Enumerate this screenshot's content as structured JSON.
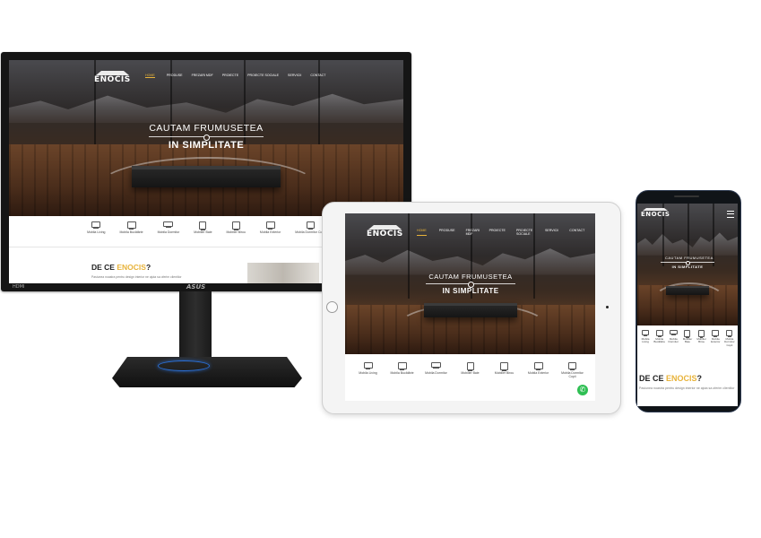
{
  "site": {
    "logo": "ENOCIS",
    "nav": [
      "Home",
      "Produse",
      "Frezari MDF",
      "Proiecte",
      "Proiecte Sociale",
      "Servicii",
      "Contact"
    ],
    "tablet_nav": [
      "Home",
      "Produse",
      "Frezari MDF",
      "Proiecte",
      "Proiecte Sociale",
      "Servicii",
      "Contact"
    ],
    "hero_line1": "CAUTAM FRUMUSETEA",
    "hero_line2": "IN SIMPLITATE",
    "categories": [
      {
        "label": "Mobila Living",
        "icon": "sofa-icon"
      },
      {
        "label": "Mobila Bucătărie",
        "icon": "kitchen-icon"
      },
      {
        "label": "Mobila Dormitor",
        "icon": "bed-icon"
      },
      {
        "label": "Mobilier Baie",
        "icon": "bath-icon"
      },
      {
        "label": "Mobilier Birou",
        "icon": "desk-icon"
      },
      {
        "label": "Mobila Exterior",
        "icon": "fence-icon"
      },
      {
        "label": "Mobila Dormitor Copii",
        "icon": "kids-bed-icon"
      }
    ],
    "about_prefix": "DE CE ",
    "about_brand": "ENOCIS",
    "about_suffix": "?",
    "about_text": "Pasiunea noastra pentru design interior ne ajuta sa oferim clientilor"
  },
  "devices": {
    "monitor_brand": "ASUS",
    "monitor_port": "HDMI"
  },
  "colors": {
    "accent": "#e8b33a",
    "whatsapp": "#2fbf53"
  }
}
